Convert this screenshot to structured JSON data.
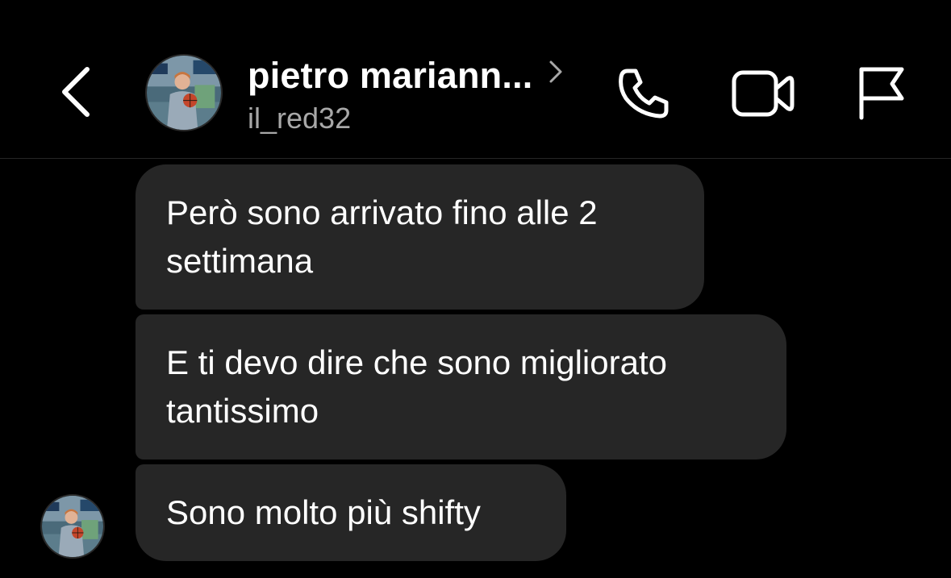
{
  "header": {
    "name": "pietro mariann...",
    "username": "il_red32",
    "icons": {
      "back": "chevron-left-icon",
      "profile_chevron": "chevron-right-icon",
      "call": "phone-icon",
      "video": "video-camera-icon",
      "report": "flag-icon"
    }
  },
  "messages": [
    {
      "text": "Però sono arrivato fino alle 2 settimana"
    },
    {
      "text": "E ti devo dire che sono migliorato tantissimo"
    },
    {
      "text": "Sono molto più shifty"
    }
  ],
  "colors": {
    "background": "#000000",
    "bubble": "#262626",
    "text": "#ffffff",
    "secondary_text": "#a8a8a8"
  }
}
